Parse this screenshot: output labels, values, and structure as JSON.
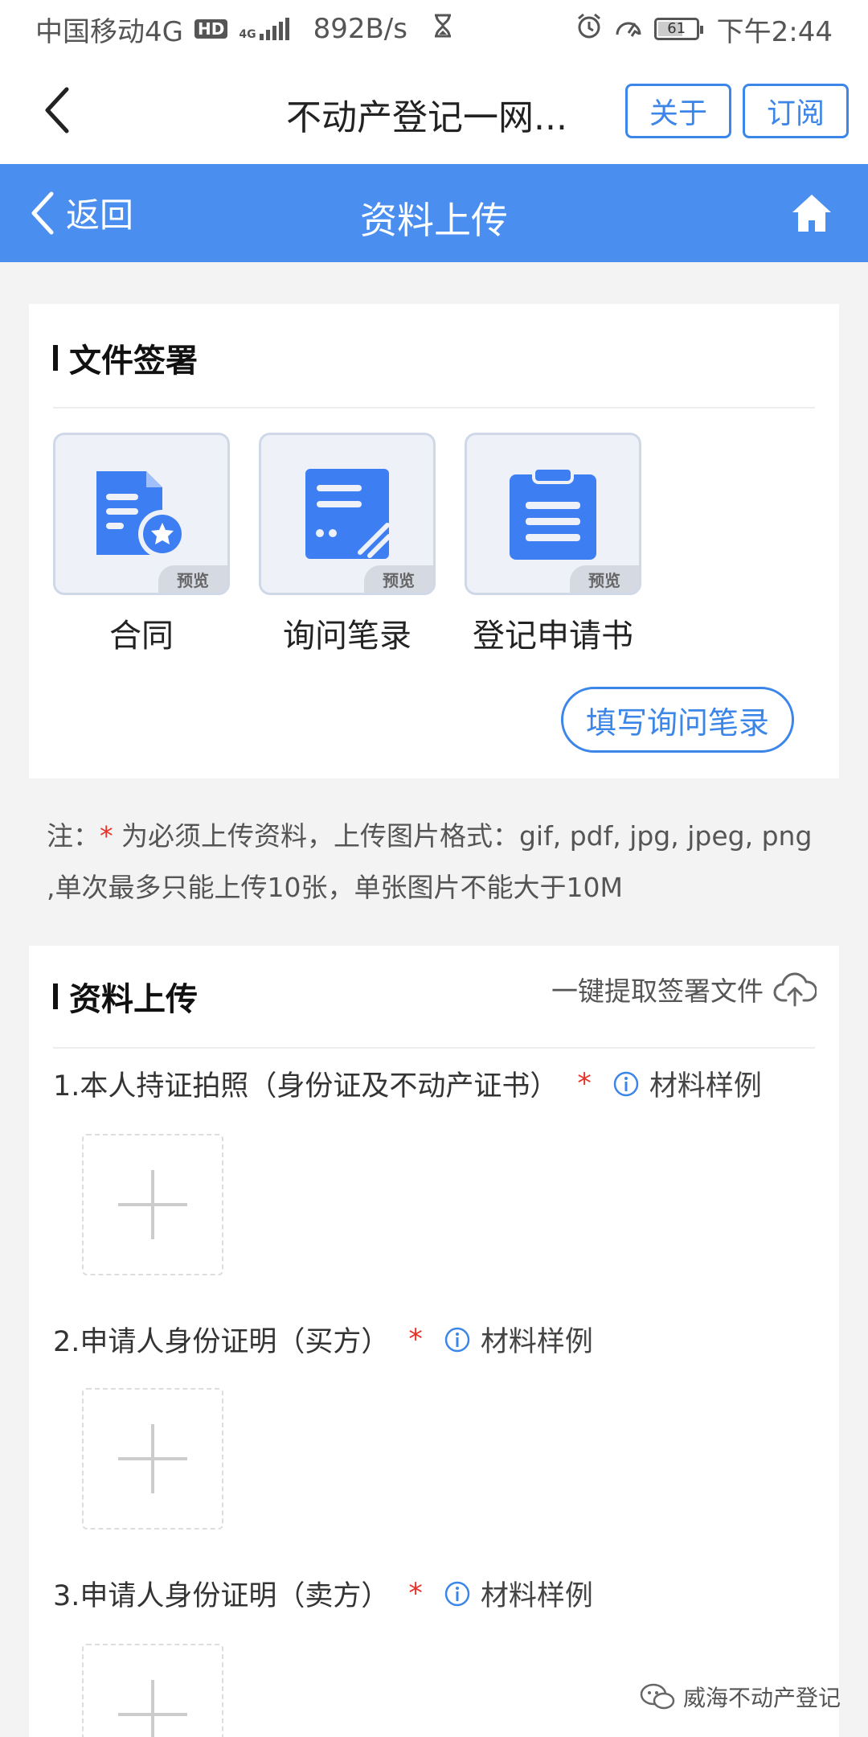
{
  "status_bar": {
    "carrier": "中国移动4G",
    "hd": "HD",
    "network": "4G",
    "speed": "892B/s",
    "battery": "61",
    "battery_level": 0.61,
    "time": "下午2:44"
  },
  "app_header": {
    "title": "不动产登记一网...",
    "about_label": "关于",
    "subscribe_label": "订阅"
  },
  "nav": {
    "back_label": "返回",
    "title": "资料上传"
  },
  "sign_section": {
    "title": "文件签署",
    "items": [
      {
        "label": "合同",
        "tag": "预览",
        "icon": "contract-icon"
      },
      {
        "label": "询问笔录",
        "tag": "预览",
        "icon": "inquiry-record-icon"
      },
      {
        "label": "登记申请书",
        "tag": "预览",
        "icon": "application-form-icon"
      }
    ],
    "fill_button": "填写询问笔录"
  },
  "note": {
    "prefix": "注：",
    "star": "*",
    "text": " 为必须上传资料，上传图片格式：gif, pdf, jpg, jpeg, png ,单次最多只能上传10张，单张图片不能大于10M"
  },
  "upload_section": {
    "title": "资料上传",
    "extract_label": "一键提取签署文件",
    "items": [
      {
        "label": "1.本人持证拍照（身份证及不动产证书）",
        "star": "*",
        "example": "材料样例"
      },
      {
        "label": "2.申请人身份证明（买方）",
        "star": "*",
        "example": "材料样例"
      },
      {
        "label": "3.申请人身份证明（卖方）",
        "star": "*",
        "example": "材料样例"
      }
    ]
  },
  "watermark": "威海不动产登记",
  "colors": {
    "primary": "#4a8ef0",
    "accent_border": "#3b86e8",
    "required": "#e5332a"
  }
}
